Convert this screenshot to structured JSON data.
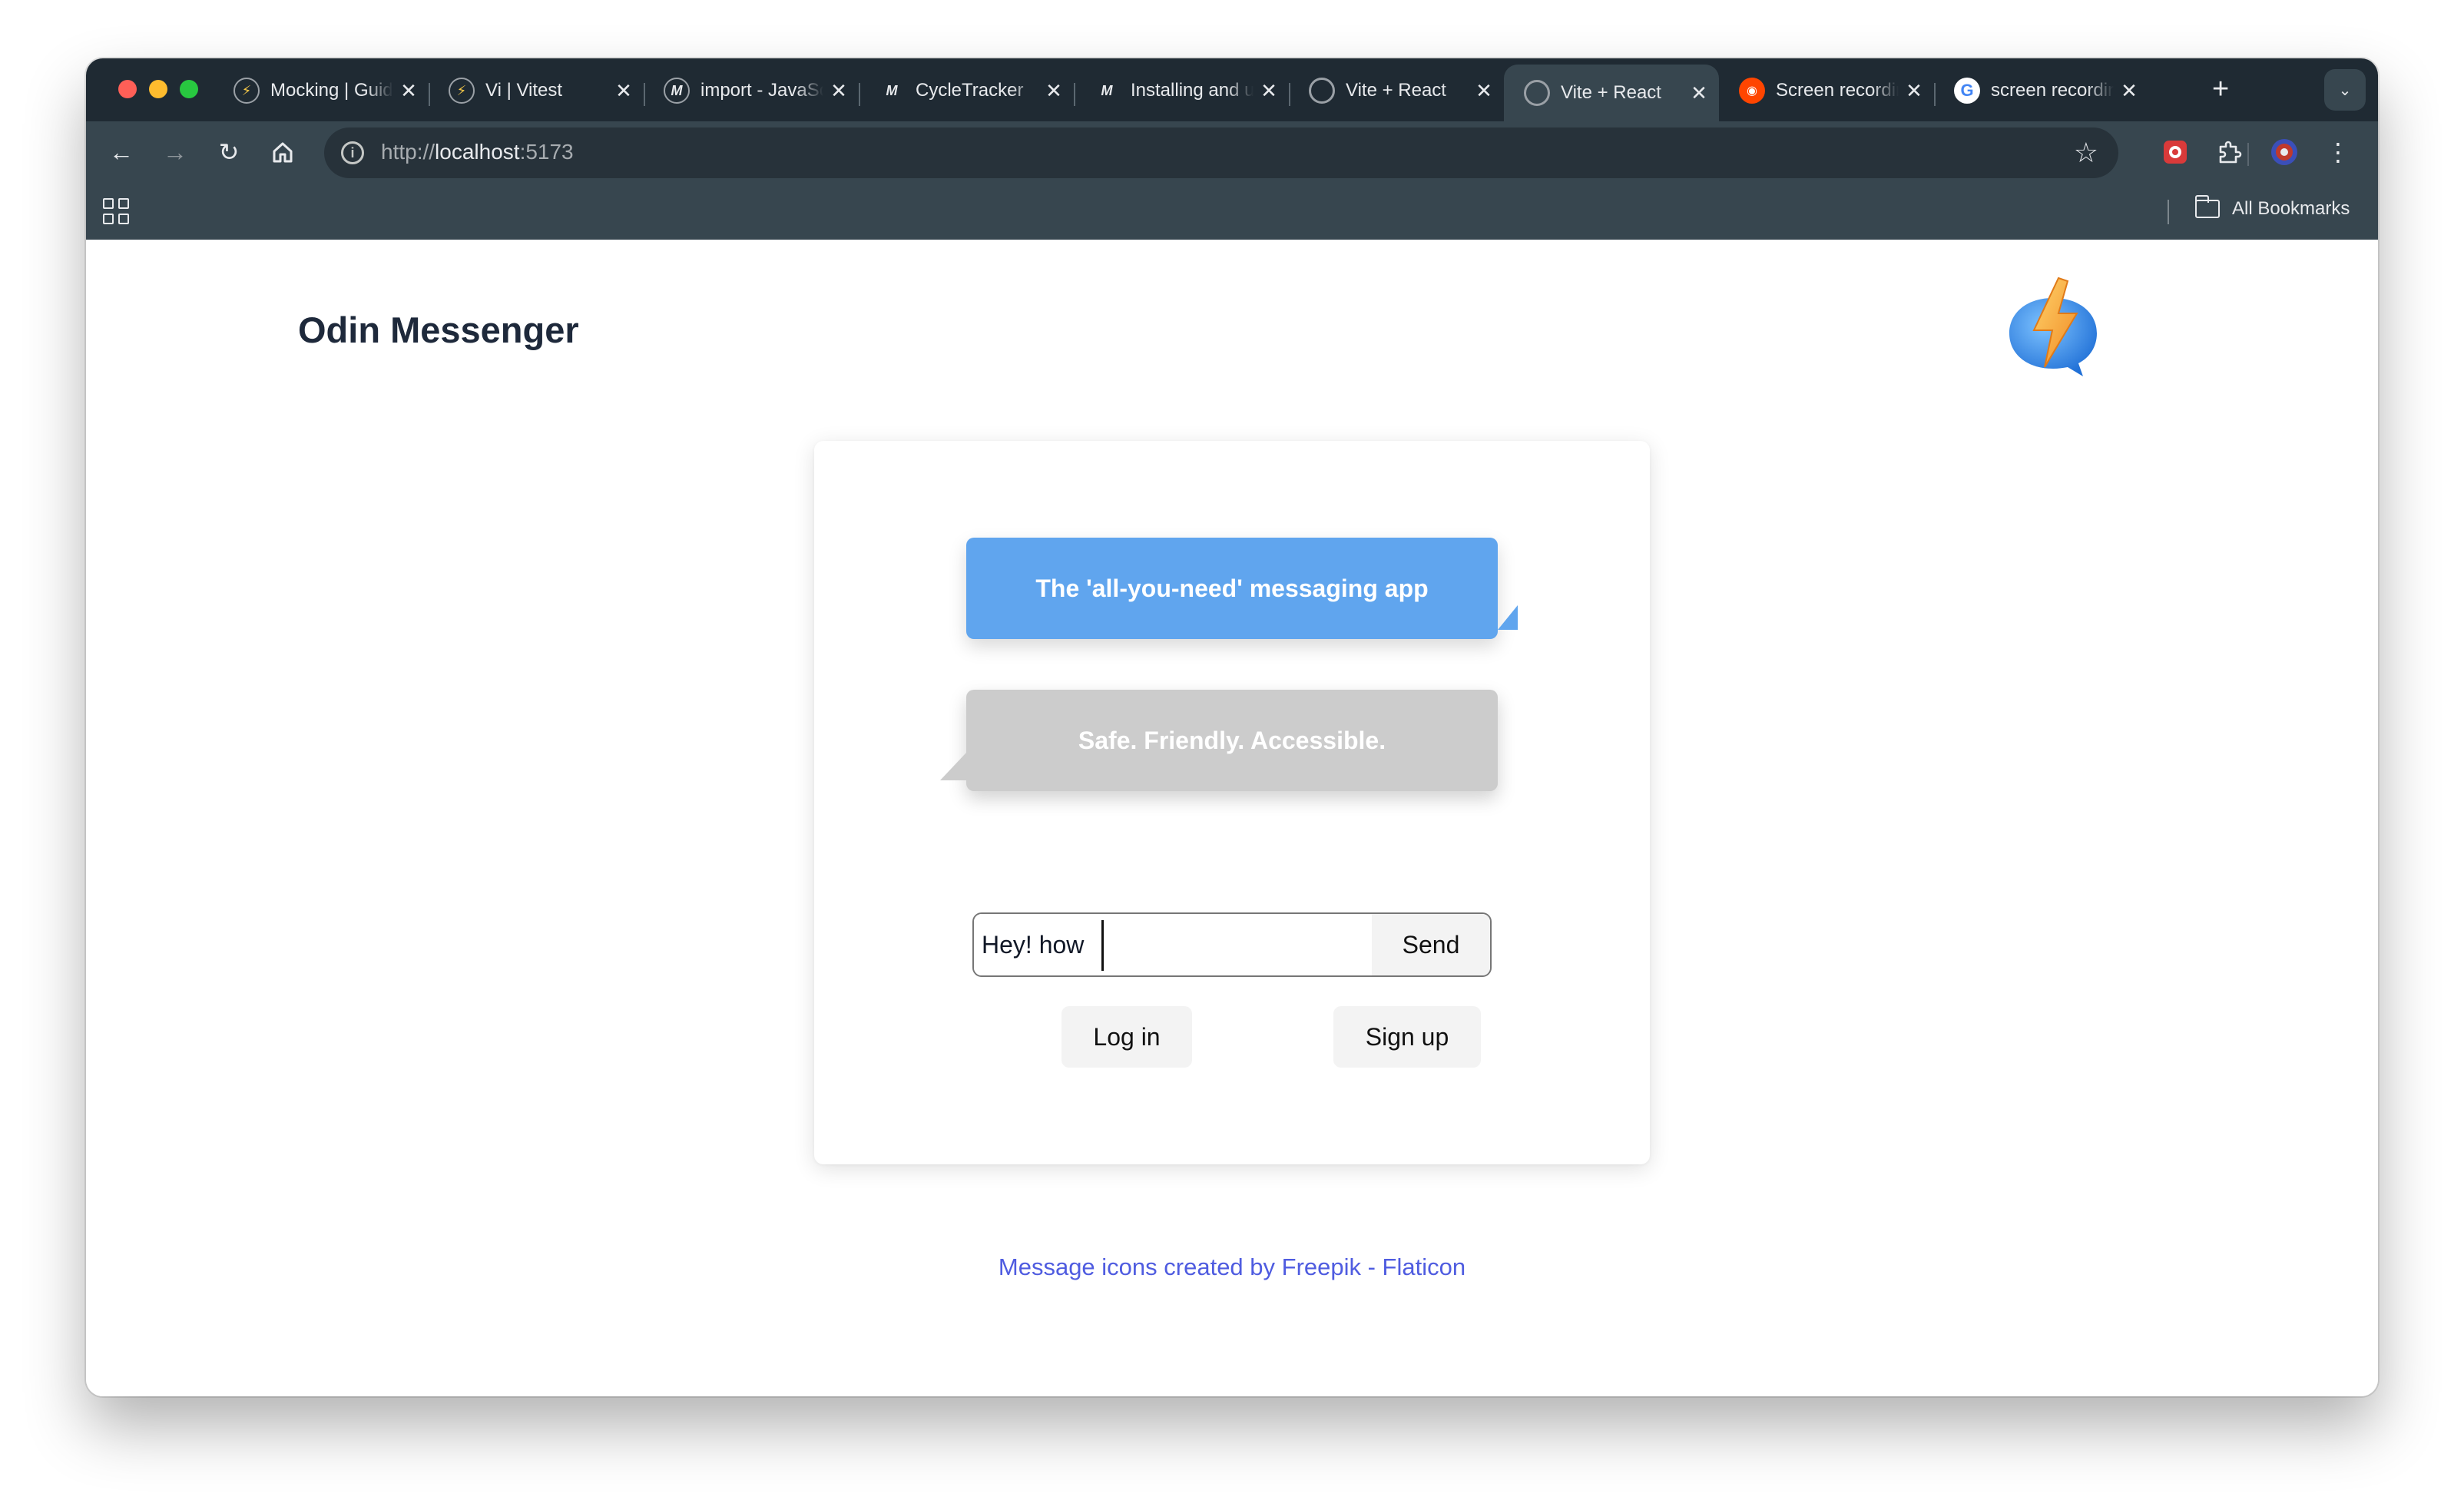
{
  "browser": {
    "tabs": [
      {
        "title": "Mocking | Guide | Vitest",
        "favicon": "vitest-icon"
      },
      {
        "title": "Vi | Vitest",
        "favicon": "vitest-icon"
      },
      {
        "title": "import - JavaScript | MDN",
        "favicon": "mdn-icon"
      },
      {
        "title": "CycleTracker",
        "favicon": "mdn-icon"
      },
      {
        "title": "Installing and uninstalling PWAs",
        "favicon": "mdn-icon"
      },
      {
        "title": "Vite + React",
        "favicon": "globe-icon"
      },
      {
        "title": "Vite + React",
        "favicon": "globe-icon",
        "active": true
      },
      {
        "title": "Screen recording",
        "favicon": "reddit-icon"
      },
      {
        "title": "screen recording",
        "favicon": "google-icon"
      }
    ],
    "url": {
      "scheme": "http://",
      "host": "localhost",
      "port": ":5173"
    },
    "bookmarks": {
      "all_label": "All Bookmarks"
    }
  },
  "page": {
    "title": "Odin Messenger",
    "tagline_primary": "The 'all-you-need' messaging app",
    "tagline_secondary": "Safe. Friendly. Accessible.",
    "message_input_value": "Hey! how",
    "send_label": "Send",
    "login_label": "Log in",
    "signup_label": "Sign up",
    "attribution": "Message icons created by Freepik - Flaticon"
  },
  "colors": {
    "browser_frame": "#1f2a33",
    "toolbar": "#37464f",
    "accent_blue": "#60a5ee",
    "bubble_gray": "#cccccc",
    "link": "#4f5ce0",
    "title": "#1e293b"
  }
}
